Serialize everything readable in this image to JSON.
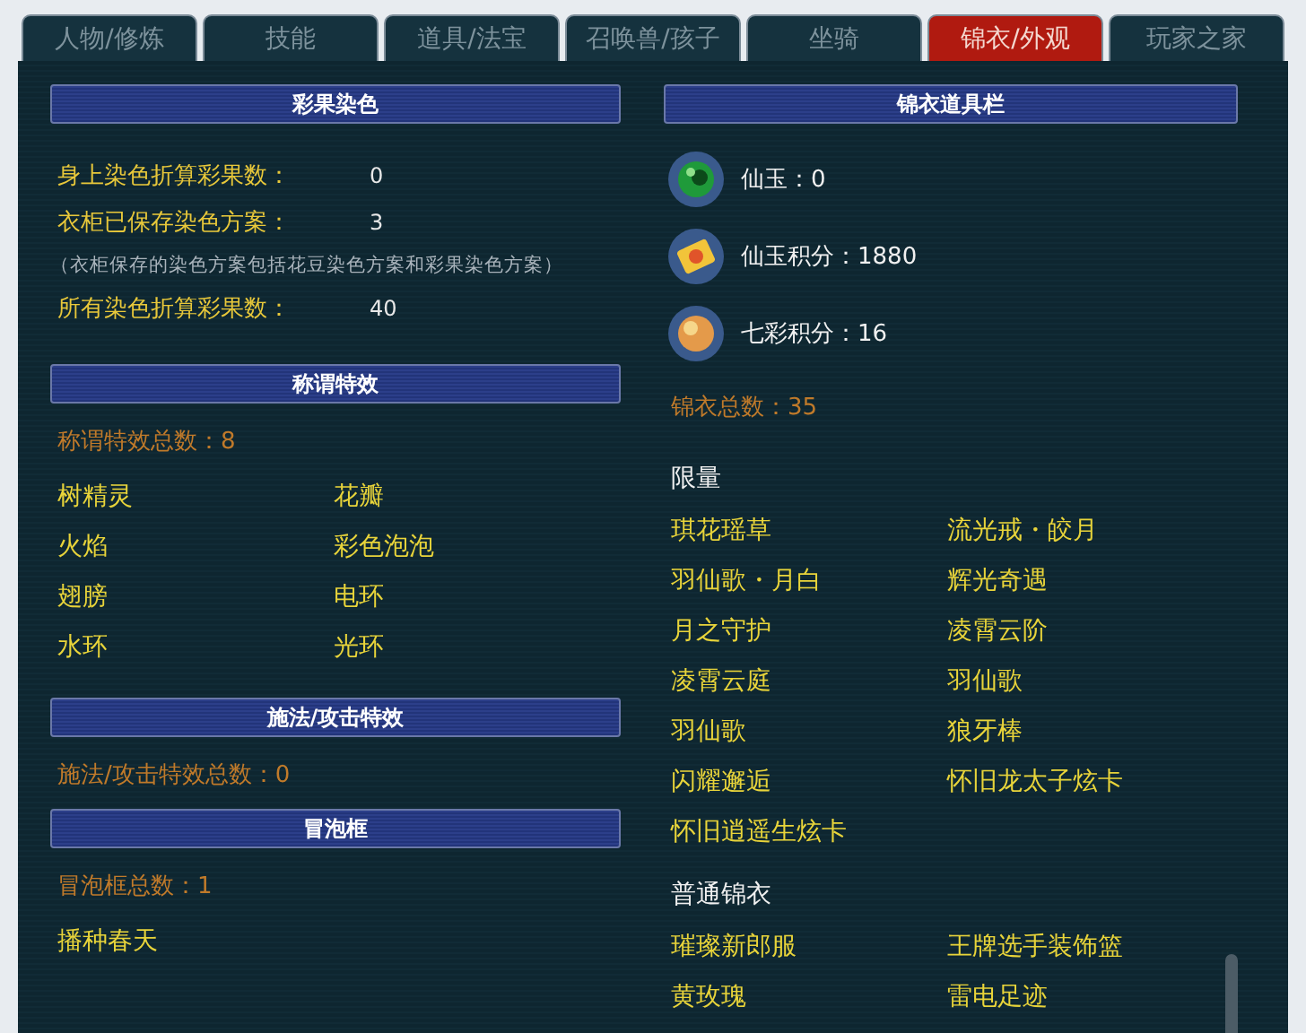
{
  "tabs": [
    {
      "label": "人物/修炼",
      "selected": false
    },
    {
      "label": "技能",
      "selected": false
    },
    {
      "label": "道具/法宝",
      "selected": false
    },
    {
      "label": "召唤兽/孩子",
      "selected": false
    },
    {
      "label": "坐骑",
      "selected": false
    },
    {
      "label": "锦衣/外观",
      "selected": true
    },
    {
      "label": "玩家之家",
      "selected": false
    }
  ],
  "left_sections": [
    {
      "title": "彩果染色",
      "kind": "stats",
      "rows": [
        {
          "kind": "stat",
          "label": "身上染色折算彩果数：",
          "value": "0"
        },
        {
          "kind": "stat",
          "label": "衣柜已保存染色方案：",
          "value": "3"
        },
        {
          "kind": "note",
          "text": "（衣柜保存的染色方案包括花豆染色方案和彩果染色方案）"
        },
        {
          "kind": "stat",
          "label": "所有染色折算彩果数：",
          "value": "40"
        }
      ]
    },
    {
      "title": "称谓特效",
      "kind": "list",
      "count": "称谓特效总数：8",
      "items": [
        "树精灵",
        "花瓣",
        "火焰",
        "彩色泡泡",
        "翅膀",
        "电环",
        "水环",
        "光环"
      ]
    },
    {
      "title": "施法/攻击特效",
      "kind": "list",
      "count": "施法/攻击特效总数：0"
    },
    {
      "title": "冒泡框",
      "kind": "list",
      "count": "冒泡框总数：1",
      "items": [
        "播种春天"
      ]
    }
  ],
  "wardrobe": {
    "title": "锦衣道具栏",
    "currencies": [
      {
        "kind": "jade",
        "label": "仙玉：0"
      },
      {
        "kind": "card",
        "label": "仙玉积分：1880"
      },
      {
        "kind": "orb",
        "label": "七彩积分：16"
      }
    ],
    "total": "锦衣总数：35",
    "groups": [
      {
        "name": "限量",
        "items": [
          "琪花瑶草",
          "流光戒・皎月",
          "羽仙歌・月白",
          "辉光奇遇",
          "月之守护",
          "凌霄云阶",
          "凌霄云庭",
          "羽仙歌",
          "羽仙歌",
          "狼牙棒",
          "闪耀邂逅",
          "怀旧龙太子炫卡",
          "怀旧逍遥生炫卡"
        ]
      },
      {
        "name": "普通锦衣",
        "items": [
          "璀璨新郎服",
          "王牌选手装饰篮",
          "黄玫瑰",
          "雷电足迹"
        ]
      }
    ]
  }
}
